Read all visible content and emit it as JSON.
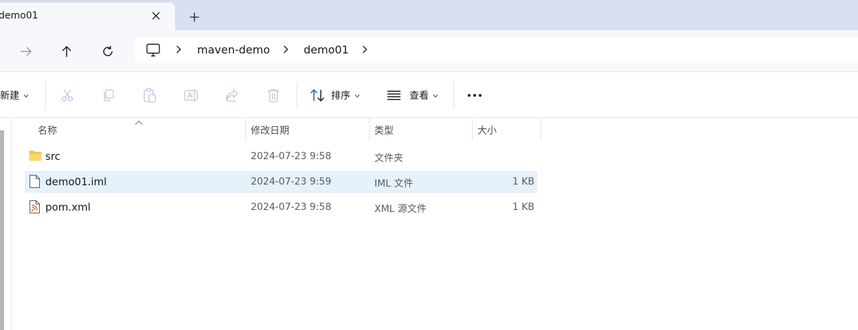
{
  "tab": {
    "title": "demo01",
    "close_icon": "close-icon",
    "new_tab_icon": "plus-icon"
  },
  "nav": {
    "back_icon": "arrow-left-icon",
    "forward_icon": "arrow-right-icon",
    "up_icon": "arrow-up-icon",
    "refresh_icon": "refresh-icon"
  },
  "address": {
    "root_icon": "this-pc-icon",
    "crumbs": [
      "maven-demo",
      "demo01"
    ]
  },
  "toolbar": {
    "new_label": "新建",
    "sort_label": "排序",
    "view_label": "查看",
    "more_icon": "more-icon",
    "disabled_icons": [
      "cut-icon",
      "copy-icon",
      "paste-icon",
      "rename-icon",
      "share-icon",
      "delete-icon"
    ]
  },
  "columns": {
    "name": "名称",
    "modified": "修改日期",
    "type": "类型",
    "size": "大小"
  },
  "files": [
    {
      "name": "src",
      "modified": "2024-07-23 9:58",
      "type": "文件夹",
      "size": "",
      "icon": "folder-icon"
    },
    {
      "name": "demo01.iml",
      "modified": "2024-07-23 9:59",
      "type": "IML 文件",
      "size": "1 KB",
      "icon": "file-icon",
      "selected": true
    },
    {
      "name": "pom.xml",
      "modified": "2024-07-23 9:58",
      "type": "XML 源文件",
      "size": "1 KB",
      "icon": "xml-file-icon"
    }
  ],
  "colors": {
    "accent": "#0067c0",
    "selection": "#e5f1fb",
    "tabstrip": "#d8dff0"
  }
}
